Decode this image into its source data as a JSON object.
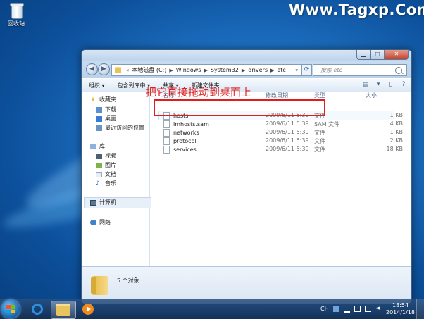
{
  "desktop": {
    "recycle_bin_label": "回收站",
    "watermark": "Www.Tagxp.Com"
  },
  "window": {
    "address": {
      "overflow": "«",
      "crumbs": [
        "本地磁盘 (C:)",
        "Windows",
        "System32",
        "drivers",
        "etc"
      ]
    },
    "search_placeholder": "搜索 etc",
    "toolbar": {
      "organize": "组织 ▾",
      "include_in_library": "包含到库中 ▾",
      "share": "共享 ▾",
      "new_folder": "新建文件夹"
    },
    "nav_pane": {
      "favorites": "收藏夹",
      "downloads": "下载",
      "desktop": "桌面",
      "recent": "最近访问的位置",
      "libraries": "库",
      "videos": "视频",
      "pictures": "图片",
      "documents": "文档",
      "music": "音乐",
      "computer": "计算机",
      "network": "网络"
    },
    "columns": {
      "name": "名称",
      "modified": "修改日期",
      "type": "类型",
      "size": "大小"
    },
    "files": [
      {
        "name": "hosts",
        "modified": "2009/6/11 5:39",
        "type": "文件",
        "size": "1 KB"
      },
      {
        "name": "lmhosts.sam",
        "modified": "2009/6/11 5:39",
        "type": "SAM 文件",
        "size": "4 KB"
      },
      {
        "name": "networks",
        "modified": "2009/6/11 5:39",
        "type": "文件",
        "size": "1 KB"
      },
      {
        "name": "protocol",
        "modified": "2009/6/11 5:39",
        "type": "文件",
        "size": "2 KB"
      },
      {
        "name": "services",
        "modified": "2009/6/11 5:39",
        "type": "文件",
        "size": "18 KB"
      }
    ],
    "status_count": "5 个对象"
  },
  "annotation": "把它直接拖动到桌面上",
  "taskbar": {
    "lang": "CH",
    "time": "18:54",
    "date": "2014/1/18"
  },
  "colors": {
    "annotation_red": "#e11d1d",
    "desktop_blue": "#1d6fc0"
  },
  "icons": [
    "recycle-bin-icon",
    "folder-icon",
    "star-icon",
    "document-icon",
    "computer-icon",
    "network-icon",
    "ie-icon",
    "explorer-icon",
    "media-player-icon",
    "windows-logo-icon"
  ]
}
